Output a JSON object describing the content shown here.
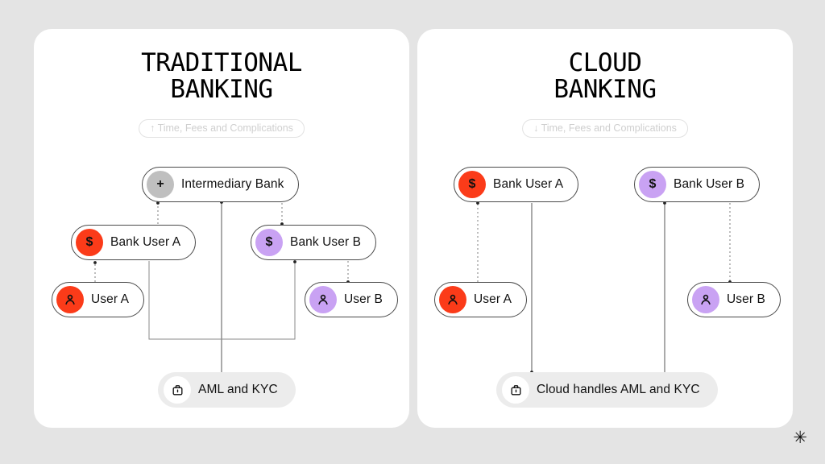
{
  "canvas": {
    "background_color": "#e4e4e4",
    "corner_mark": "✳"
  },
  "colors": {
    "panel_background": "#ffffff",
    "accent_red": "#fb3b19",
    "accent_purple": "#c9a2f3",
    "neutral_gray": "#bfbfbf",
    "shaded_node": "#ececec",
    "node_border": "#4a4a4a",
    "subtitle_text": "#cfcfcf"
  },
  "panels": [
    {
      "id": "traditional-banking",
      "title": "TRADITIONAL\nBANKING",
      "subtitle": "↑ Time, Fees and Complications",
      "subtitle_direction": "up",
      "nodes": [
        {
          "id": "intermediary-bank",
          "label": "Intermediary Bank",
          "icon": "plus-icon",
          "icon_glyph": "+",
          "badge_color": "gray",
          "style": "outlined"
        },
        {
          "id": "bank-user-a",
          "label": "Bank User A",
          "icon": "dollar-icon",
          "icon_glyph": "$",
          "badge_color": "red",
          "style": "outlined"
        },
        {
          "id": "bank-user-b",
          "label": "Bank User B",
          "icon": "dollar-icon",
          "icon_glyph": "$",
          "badge_color": "purple",
          "style": "outlined"
        },
        {
          "id": "user-a",
          "label": "User A",
          "icon": "person-icon",
          "icon_glyph": "",
          "badge_color": "red",
          "style": "outlined"
        },
        {
          "id": "user-b",
          "label": "User B",
          "icon": "person-icon",
          "icon_glyph": "",
          "badge_color": "purple",
          "style": "outlined"
        },
        {
          "id": "aml-kyc",
          "label": "AML and KYC",
          "icon": "briefcase-icon",
          "icon_glyph": "",
          "badge_color": "white",
          "style": "shaded"
        }
      ]
    },
    {
      "id": "cloud-banking",
      "title": "CLOUD\nBANKING",
      "subtitle": "↓ Time, Fees and Complications",
      "subtitle_direction": "down",
      "nodes": [
        {
          "id": "bank-user-a",
          "label": "Bank User A",
          "icon": "dollar-icon",
          "icon_glyph": "$",
          "badge_color": "red",
          "style": "outlined"
        },
        {
          "id": "bank-user-b",
          "label": "Bank User B",
          "icon": "dollar-icon",
          "icon_glyph": "$",
          "badge_color": "purple",
          "style": "outlined"
        },
        {
          "id": "user-a",
          "label": "User A",
          "icon": "person-icon",
          "icon_glyph": "",
          "badge_color": "red",
          "style": "outlined"
        },
        {
          "id": "user-b",
          "label": "User B",
          "icon": "person-icon",
          "icon_glyph": "",
          "badge_color": "purple",
          "style": "outlined"
        },
        {
          "id": "cloud-aml-kyc",
          "label": "Cloud handles AML and KYC",
          "icon": "briefcase-icon",
          "icon_glyph": "",
          "badge_color": "white",
          "style": "shaded"
        }
      ]
    }
  ]
}
